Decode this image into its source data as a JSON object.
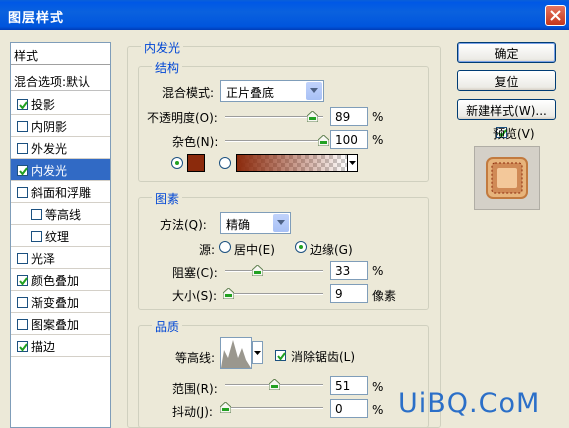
{
  "window": {
    "title": "图层样式"
  },
  "style_list": {
    "header": "样式",
    "blend_options": "混合选项:默认",
    "items": [
      {
        "label": "投影",
        "checked": true,
        "selected": false
      },
      {
        "label": "内阴影",
        "checked": false,
        "selected": false
      },
      {
        "label": "外发光",
        "checked": false,
        "selected": false
      },
      {
        "label": "内发光",
        "checked": true,
        "selected": true
      },
      {
        "label": "斜面和浮雕",
        "checked": false,
        "selected": false
      },
      {
        "label": "等高线",
        "checked": false,
        "selected": false
      },
      {
        "label": "纹理",
        "checked": false,
        "selected": false
      },
      {
        "label": "光泽",
        "checked": false,
        "selected": false
      },
      {
        "label": "颜色叠加",
        "checked": true,
        "selected": false
      },
      {
        "label": "渐变叠加",
        "checked": false,
        "selected": false
      },
      {
        "label": "图案叠加",
        "checked": false,
        "selected": false
      },
      {
        "label": "描边",
        "checked": true,
        "selected": false
      }
    ]
  },
  "inner_glow": {
    "title": "内发光",
    "structure": {
      "title": "结构",
      "blend_mode_label": "混合模式:",
      "blend_mode_value": "正片叠底",
      "opacity_label": "不透明度(O):",
      "opacity_value": "89",
      "opacity_unit": "%",
      "opacity_level": 0.89,
      "noise_label": "杂色(N):",
      "noise_value": "100",
      "noise_unit": "%",
      "noise_level": 1.0,
      "glow_color": "#8B2A0C",
      "gradient_color": "#8B2A0C"
    },
    "elements": {
      "title": "图素",
      "method_label": "方法(Q):",
      "method_value": "精确",
      "source_label": "源:",
      "source_center": "居中(E)",
      "source_edge": "边缘(G)",
      "choke_label": "阻塞(C):",
      "choke_value": "33",
      "choke_unit": "%",
      "choke_level": 0.33,
      "size_label": "大小(S):",
      "size_value": "9",
      "size_unit": "像素",
      "size_level": 0.036
    },
    "quality": {
      "title": "品质",
      "contour_label": "等高线:",
      "antialias_label": "消除锯齿(L)",
      "range_label": "范围(R):",
      "range_value": "51",
      "range_unit": "%",
      "range_level": 0.51,
      "jitter_label": "抖动(J):",
      "jitter_value": "0",
      "jitter_unit": "%",
      "jitter_level": 0.0
    }
  },
  "buttons": {
    "ok": "确定",
    "reset": "复位",
    "new_style": "新建样式(W)...",
    "preview": "预览(V)"
  },
  "watermark": "UiBQ.CoM"
}
